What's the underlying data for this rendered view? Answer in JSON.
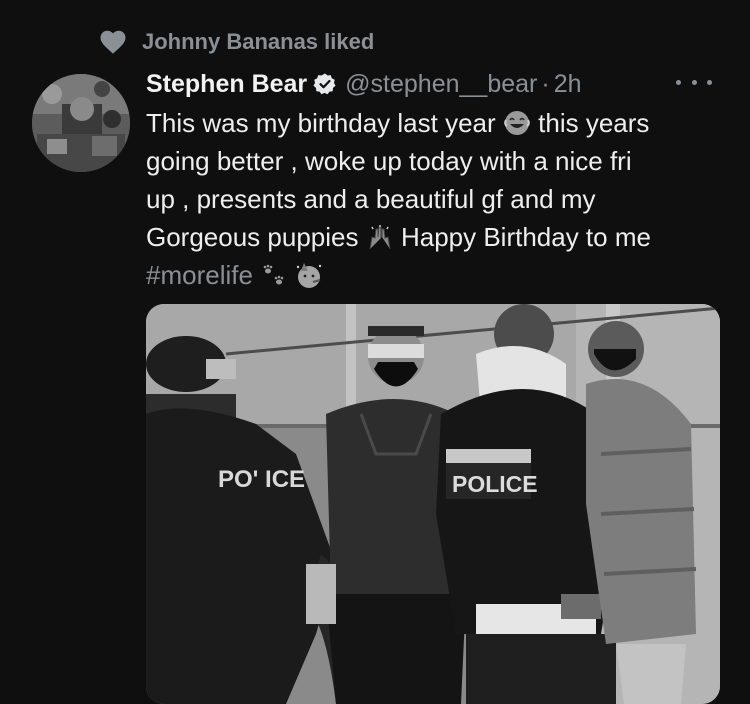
{
  "social_context": {
    "icon": "heart-icon",
    "text": "Johnny Bananas liked"
  },
  "tweet": {
    "author": {
      "display_name": "Stephen Bear",
      "handle": "@stephen__bear",
      "verified_icon": "verified-badge-icon"
    },
    "separator": "·",
    "time": "2h",
    "more_icon": "more-options-icon",
    "text": {
      "line1_a": "This was my birthday last year",
      "line1_b": "this years",
      "line2": "going better , woke up today with a nice fri",
      "line3": "up , presents and a beautiful gf and my",
      "line4_a": "Gorgeous puppies",
      "line4_b": "Happy Birthday to me",
      "hashtag": "#morelife"
    },
    "emojis": [
      "laughing-tears-emoji",
      "raised-hands-emoji",
      "paw-prints-emoji",
      "party-face-emoji"
    ],
    "media": {
      "type": "photo",
      "vest_label_left": "PO' ICE",
      "vest_label_right": "POLICE"
    }
  },
  "colors": {
    "background": "#0f0f0f",
    "primary_text": "#eeeeee",
    "secondary_text": "#8b9096"
  }
}
